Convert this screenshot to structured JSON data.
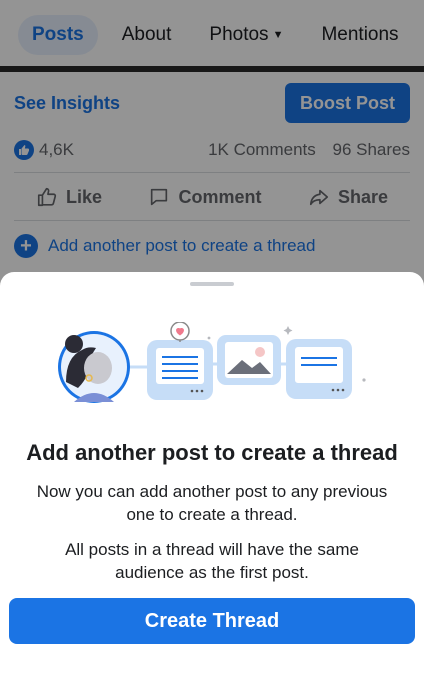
{
  "tabs": [
    {
      "label": "Posts",
      "active": true
    },
    {
      "label": "About",
      "active": false
    },
    {
      "label": "Photos",
      "active": false,
      "has_dropdown": true
    },
    {
      "label": "Mentions",
      "active": false
    }
  ],
  "post": {
    "insights_label": "See Insights",
    "boost_label": "Boost Post",
    "likes_count": "4,6K",
    "comments": "1K Comments",
    "shares": "96 Shares",
    "actions": {
      "like": "Like",
      "comment": "Comment",
      "share": "Share"
    },
    "add_thread_label": "Add another post to create a thread"
  },
  "sheet": {
    "title": "Add another post to create a thread",
    "text_1": "Now you can add another post to any previous one to create a thread.",
    "text_2": "All posts in a thread will have the same audience as the first post.",
    "button_label": "Create Thread"
  },
  "colors": {
    "accent": "#1b74e4",
    "tab_active_bg": "#e7f0fd",
    "text_secondary": "#65676b",
    "overlay": "rgba(0,0,0,0.42)"
  },
  "icons": [
    "dropdown-caret-icon",
    "like-badge-icon",
    "thumbs-up-icon",
    "comment-icon",
    "share-icon",
    "plus-circle-icon"
  ]
}
